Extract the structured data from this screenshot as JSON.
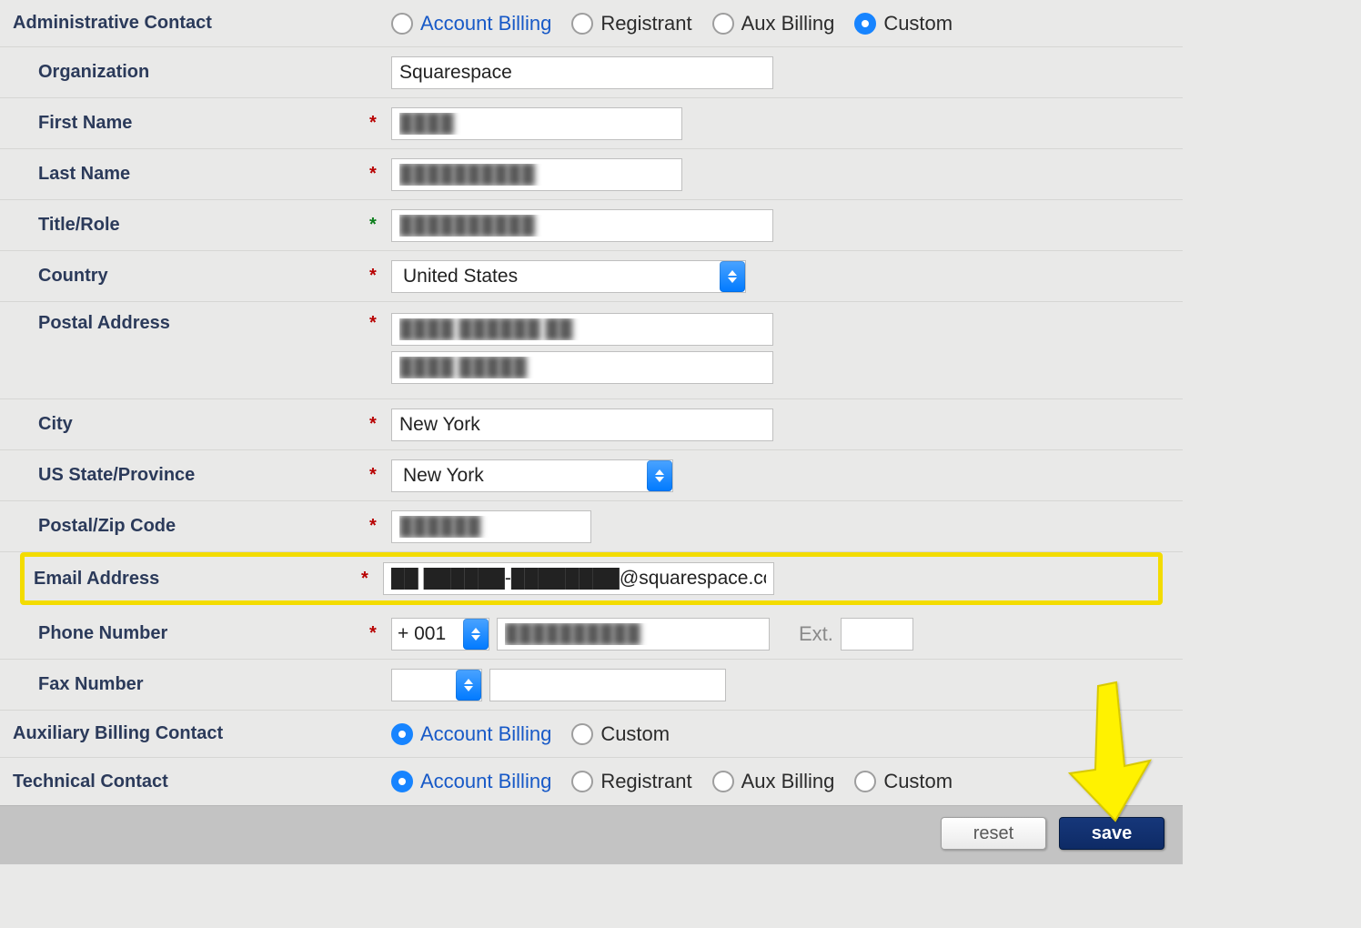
{
  "sections": {
    "admin": {
      "title": "Administrative Contact",
      "radios": {
        "account_billing": "Account Billing",
        "registrant": "Registrant",
        "aux_billing": "Aux Billing",
        "custom": "Custom",
        "selected": "custom"
      }
    },
    "auxbilling": {
      "title": "Auxiliary Billing Contact",
      "radios": {
        "account_billing": "Account Billing",
        "custom": "Custom",
        "selected": "account_billing"
      }
    },
    "tech": {
      "title": "Technical Contact",
      "radios": {
        "account_billing": "Account Billing",
        "registrant": "Registrant",
        "aux_billing": "Aux Billing",
        "custom": "Custom",
        "selected": "account_billing"
      }
    }
  },
  "fields": {
    "organization": {
      "label": "Organization",
      "value": "Squarespace"
    },
    "first_name": {
      "label": "First Name",
      "value": "████"
    },
    "last_name": {
      "label": "Last Name",
      "value": "██████████"
    },
    "title_role": {
      "label": "Title/Role",
      "value": "██████████"
    },
    "country": {
      "label": "Country",
      "value": "United States"
    },
    "postal_addr": {
      "label": "Postal Address",
      "line1": "████ ██████ ██",
      "line2": "████ █████"
    },
    "city": {
      "label": "City",
      "value": "New York"
    },
    "state": {
      "label": "US State/Province",
      "value": "New York"
    },
    "zip": {
      "label": "Postal/Zip Code",
      "value": "██████"
    },
    "email": {
      "label": "Email Address",
      "value": "██ ██████-████████@squarespace.com"
    },
    "phone": {
      "label": "Phone Number",
      "code": "+ 001",
      "value": "██████████",
      "ext_label": "Ext.",
      "ext": ""
    },
    "fax": {
      "label": "Fax Number",
      "code": "",
      "value": ""
    }
  },
  "buttons": {
    "reset": "reset",
    "save": "save"
  }
}
